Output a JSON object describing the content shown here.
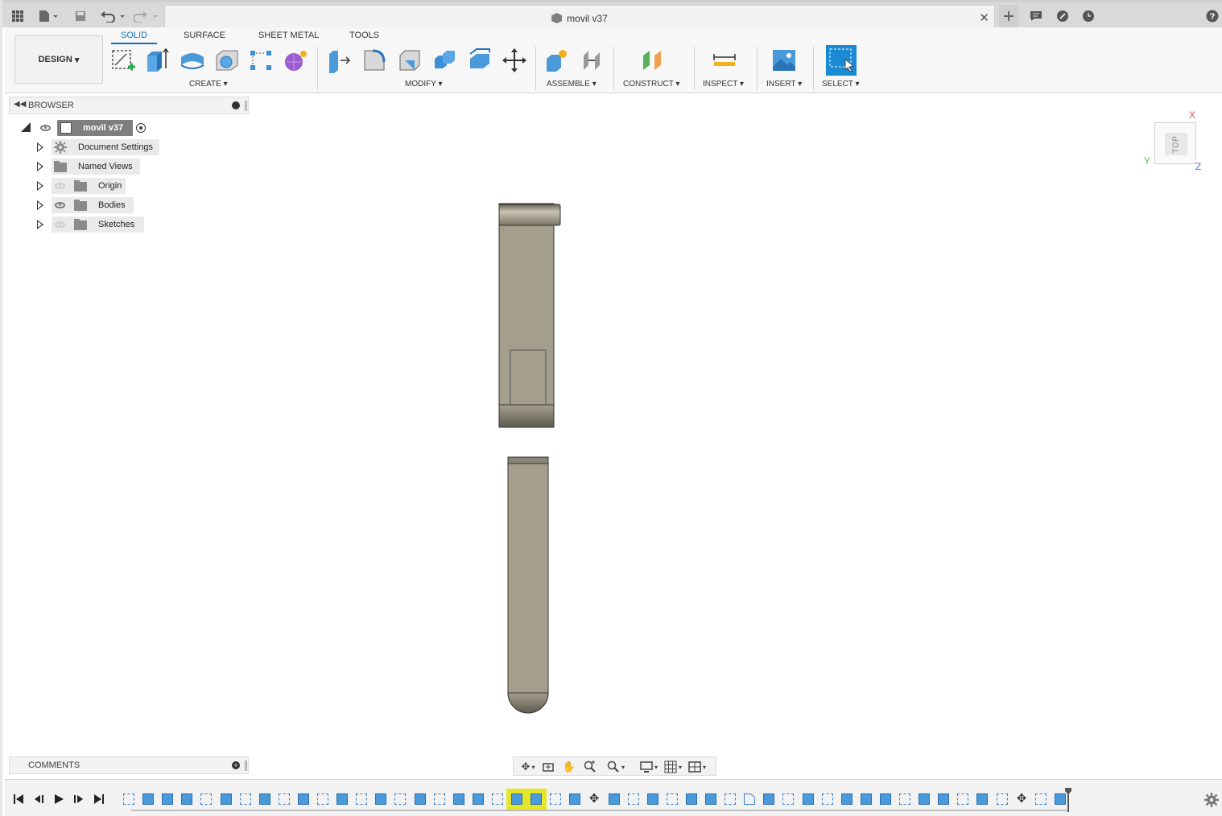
{
  "document": {
    "title": "movil v37"
  },
  "toolbar": {
    "tabs": [
      "SOLID",
      "SURFACE",
      "SHEET METAL",
      "TOOLS"
    ],
    "workspace": "DESIGN",
    "groups": {
      "create": "CREATE",
      "modify": "MODIFY",
      "assemble": "ASSEMBLE",
      "construct": "CONSTRUCT",
      "inspect": "INSPECT",
      "insert": "INSERT",
      "select": "SELECT"
    }
  },
  "browser": {
    "header": "BROWSER",
    "root": "movil v37",
    "items": [
      {
        "label": "Document Settings",
        "icon": "gear-icon",
        "visible": null
      },
      {
        "label": "Named Views",
        "icon": "folder-icon",
        "visible": null
      },
      {
        "label": "Origin",
        "icon": "folder-icon",
        "visible": false
      },
      {
        "label": "Bodies",
        "icon": "folder-icon",
        "visible": true
      },
      {
        "label": "Sketches",
        "icon": "folder-icon",
        "visible": false
      }
    ]
  },
  "viewcube": {
    "face": "TOP",
    "axes": {
      "x": "X",
      "y": "Y",
      "z": "Z"
    }
  },
  "comments": {
    "header": "COMMENTS"
  },
  "colors": {
    "accent": "#0a6fc2",
    "body_fill": "#a49e8c",
    "timeline_highlight": "#e5e52a"
  },
  "timeline": {
    "features": [
      "sketch",
      "body",
      "body",
      "body",
      "sketch",
      "body",
      "sketch",
      "body",
      "sketch",
      "body",
      "sketch",
      "body",
      "sketch",
      "body",
      "sketch",
      "body",
      "sketch",
      "body",
      "body",
      "sketch",
      "body-hl",
      "body-hl",
      "sketch",
      "body",
      "move",
      "body",
      "sketch",
      "body",
      "sketch",
      "body",
      "body",
      "sketch",
      "fillet",
      "body",
      "sketch",
      "body",
      "sketch",
      "body",
      "body",
      "body",
      "sketch",
      "body",
      "body",
      "sketch",
      "body",
      "sketch",
      "move",
      "sketch",
      "body"
    ]
  }
}
